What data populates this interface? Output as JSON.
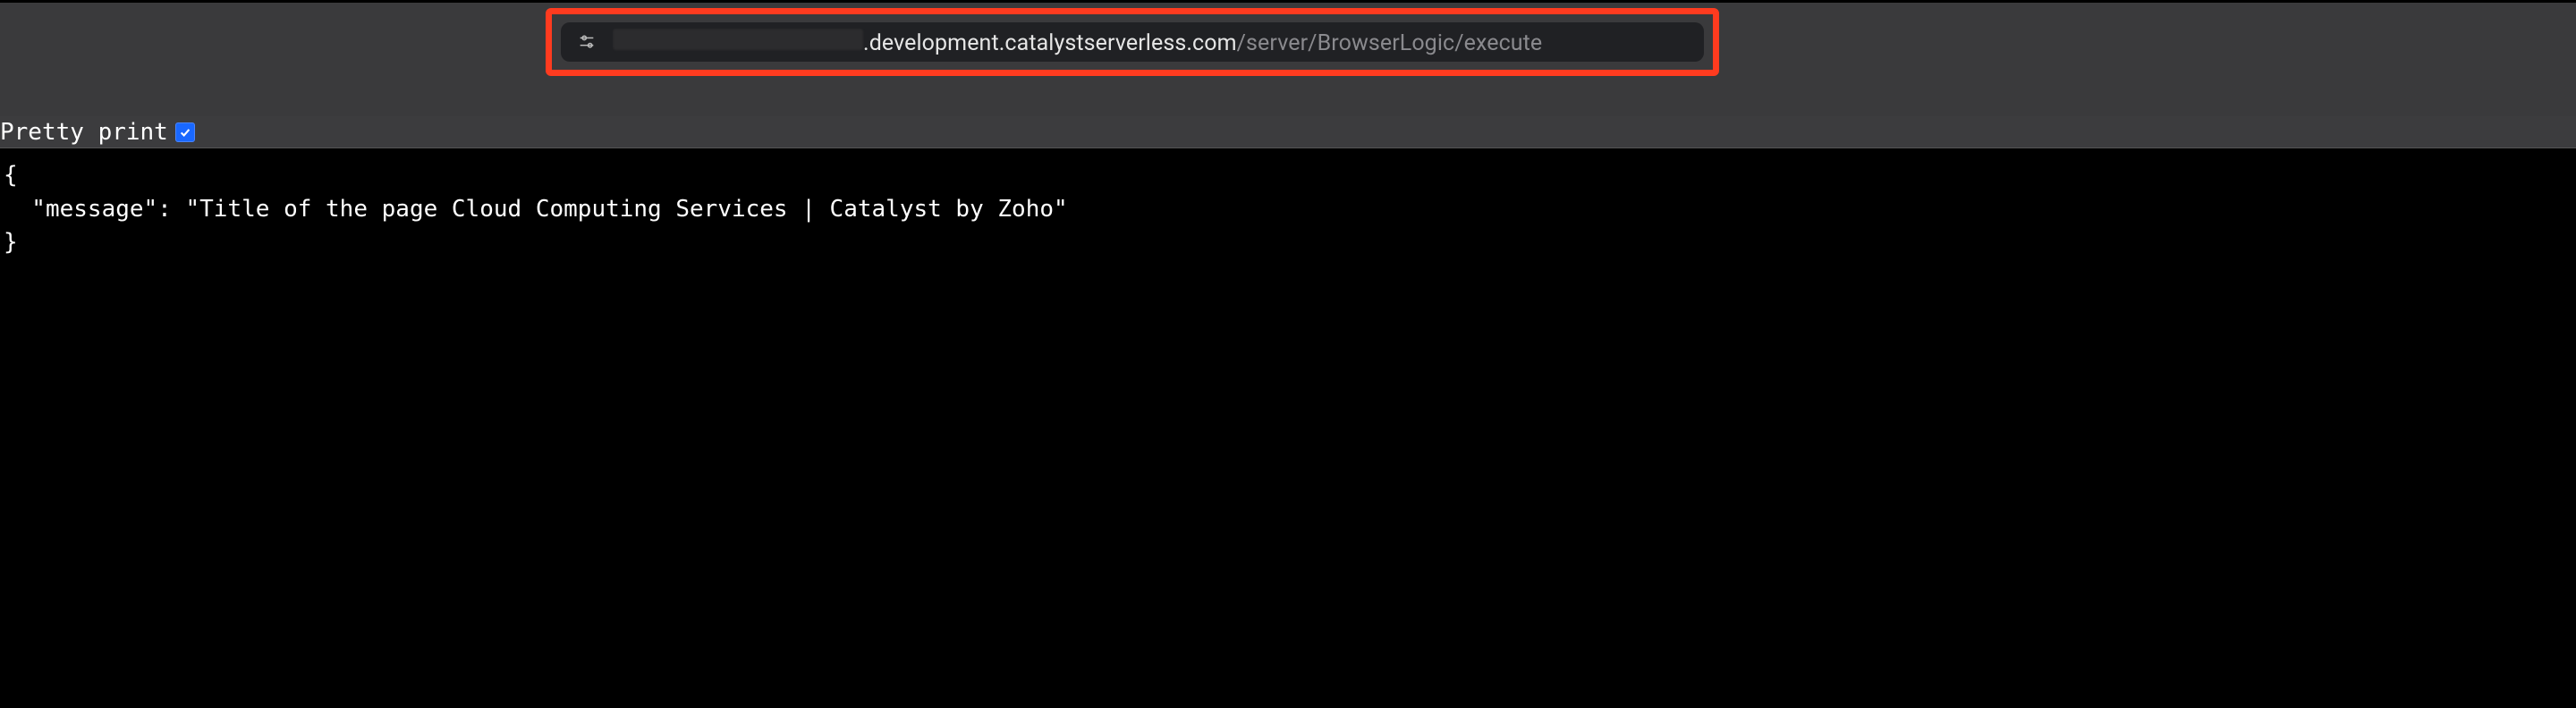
{
  "address": {
    "redacted_prefix": true,
    "host_visible": ".development.catalystserverless.com",
    "path": "/server/BrowserLogic/execute"
  },
  "pretty_print": {
    "label": "Pretty print",
    "checked": true
  },
  "json_response": {
    "line1": "{",
    "line2": "  \"message\": \"Title of the page Cloud Computing Services | Catalyst by Zoho\"",
    "line3": "}"
  }
}
